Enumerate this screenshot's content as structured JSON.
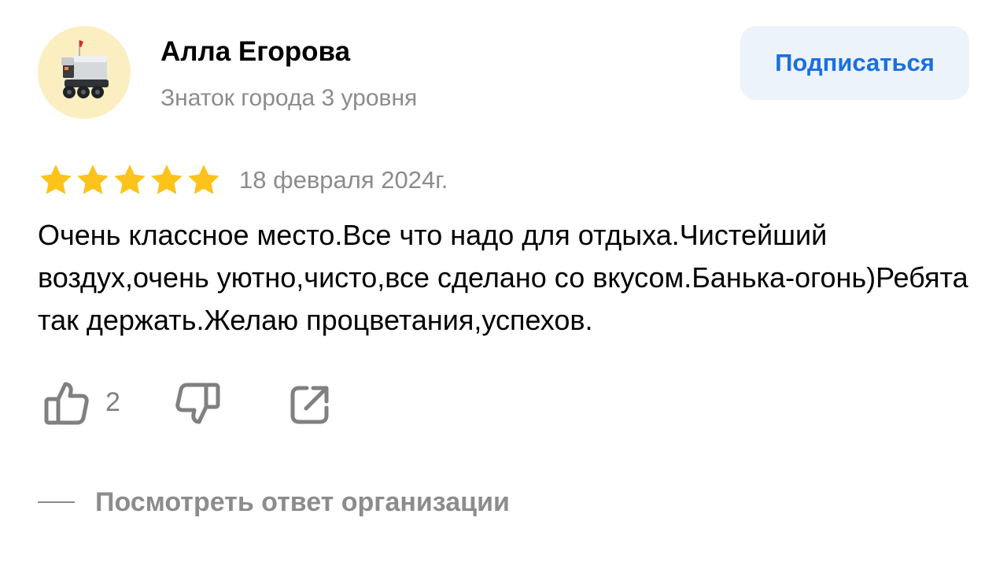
{
  "author": {
    "name": "Алла Егорова",
    "level": "Знаток города 3 уровня",
    "avatar_icon": "delivery-robot-icon",
    "avatar_bg": "#fbeec0"
  },
  "subscribe_button": {
    "label": "Подписаться",
    "bg": "#edf3fa",
    "color": "#1a6fe0"
  },
  "review": {
    "rating": 5,
    "rating_max": 5,
    "star_color": "#fcc31b",
    "date": "18 февраля 2024г.",
    "text": "Очень классное место.Все что надо для отдыха.Чистейший воздух,очень уютно,чисто,все сделано со вкусом.Банька-огонь)Ребята так держать.Желаю процветания,успехов."
  },
  "actions": {
    "like_icon": "thumbs-up-icon",
    "like_count": "2",
    "dislike_icon": "thumbs-down-icon",
    "share_icon": "share-icon"
  },
  "organization_reply": {
    "label": "Посмотреть ответ организации"
  }
}
